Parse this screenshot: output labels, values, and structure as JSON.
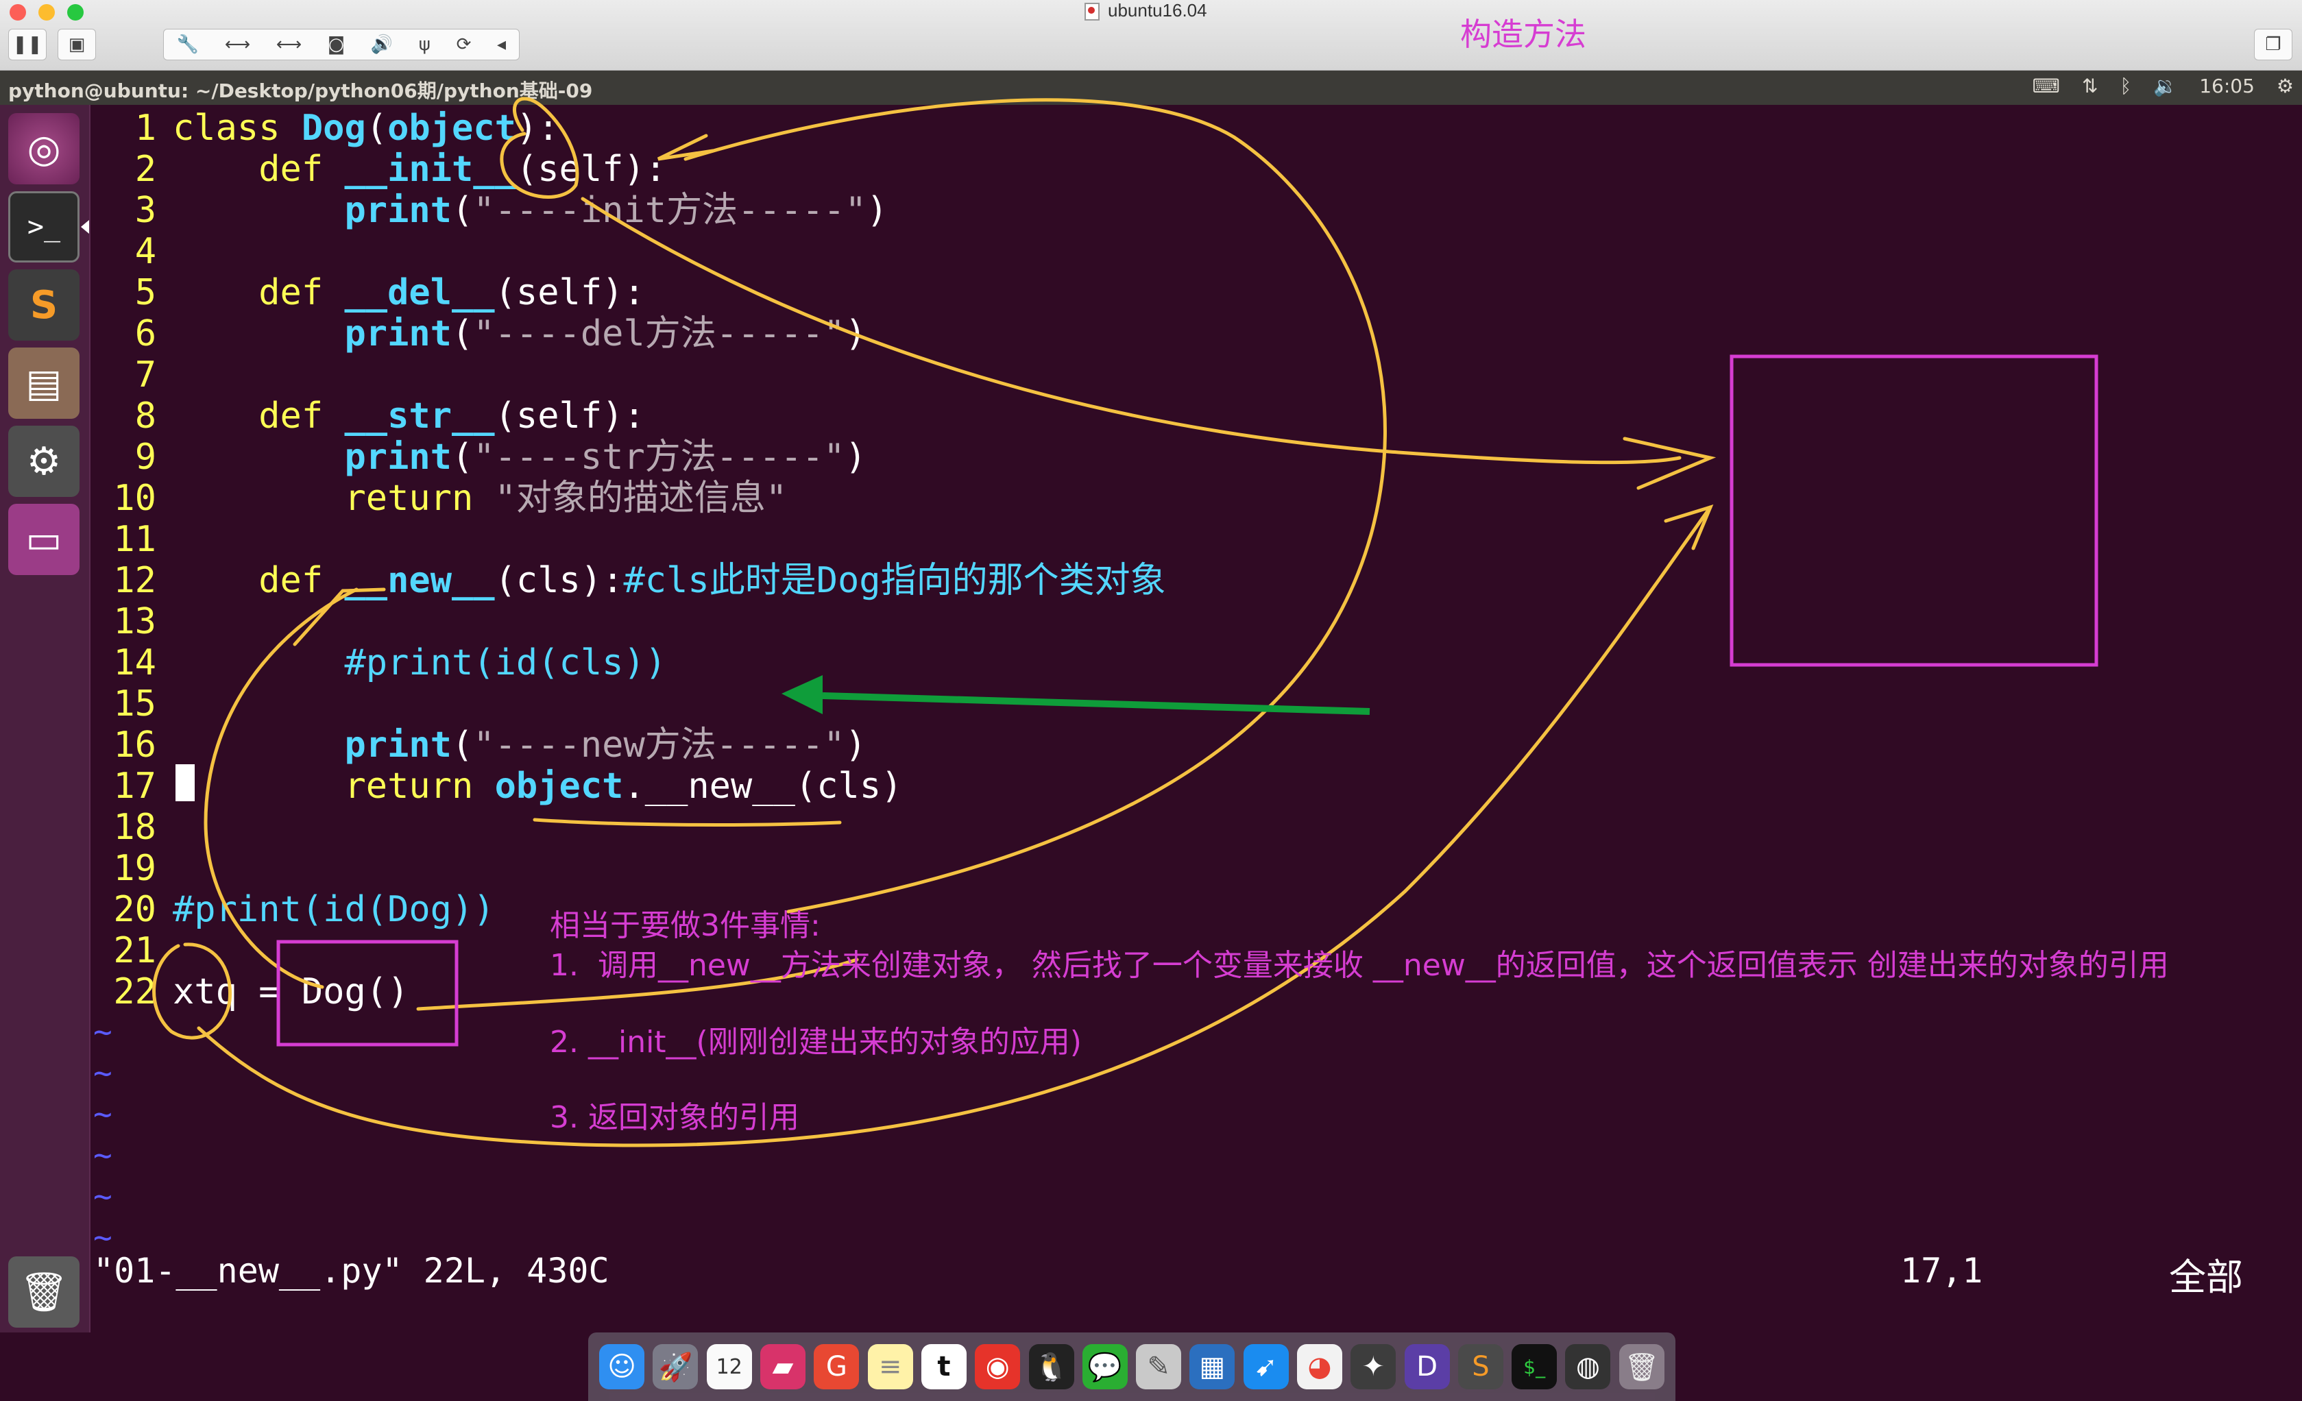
{
  "window": {
    "title": "ubuntu16.04",
    "overlay_title": "构造方法"
  },
  "panel": {
    "title": "python@ubuntu: ~/Desktop/python06期/python基础-09",
    "time": "16:05"
  },
  "launcher": {
    "apps": [
      "ubuntu-dash",
      "terminal",
      "sublime-text",
      "file-manager",
      "system-settings",
      "workspace-switcher",
      "trash"
    ]
  },
  "editor": {
    "lines": [
      {
        "n": "1",
        "text": "class Dog(object):"
      },
      {
        "n": "2",
        "text": "    def __init__(self):"
      },
      {
        "n": "3",
        "text": "        print(\"----init方法-----\")"
      },
      {
        "n": "4",
        "text": ""
      },
      {
        "n": "5",
        "text": "    def __del__(self):"
      },
      {
        "n": "6",
        "text": "        print(\"----del方法-----\")"
      },
      {
        "n": "7",
        "text": ""
      },
      {
        "n": "8",
        "text": "    def __str__(self):"
      },
      {
        "n": "9",
        "text": "        print(\"----str方法-----\")"
      },
      {
        "n": "10",
        "text": "        return \"对象的描述信息\""
      },
      {
        "n": "11",
        "text": ""
      },
      {
        "n": "12",
        "text": "    def __new__(cls):#cls此时是Dog指向的那个类对象"
      },
      {
        "n": "13",
        "text": ""
      },
      {
        "n": "14",
        "text": "        #print(id(cls))"
      },
      {
        "n": "15",
        "text": ""
      },
      {
        "n": "16",
        "text": "        print(\"----new方法-----\")"
      },
      {
        "n": "17",
        "text": "        return object.__new__(cls)"
      },
      {
        "n": "18",
        "text": ""
      },
      {
        "n": "19",
        "text": ""
      },
      {
        "n": "20",
        "text": "#print(id(Dog))"
      },
      {
        "n": "21",
        "text": ""
      },
      {
        "n": "22",
        "text": "xtq = Dog()"
      }
    ],
    "tilde_count": 6,
    "status_file": "\"01-__new__.py\" 22L, 430C",
    "status_position": "17,1",
    "status_all": "全部"
  },
  "annotations": {
    "heading": "相当于要做3件事情:",
    "step1": "1.  调用__new__方法来创建对象， 然后找了一个变量来接收 __new__的返回值，这个返回值表示 创建出来的对象的引用",
    "step2": "2. __init__(刚刚创建出来的对象的应用)",
    "step3": "3. 返回对象的引用",
    "colors": {
      "pen": "#f5c242",
      "box": "#d63dd2",
      "arrow": "#0f9d3a"
    }
  },
  "dock": {
    "apps": [
      "finder",
      "launchpad",
      "calendar",
      "photo-booth",
      "git-client",
      "notes",
      "typora",
      "weibo",
      "qq",
      "wechat",
      "script-editor",
      "vmware-fusion",
      "safari",
      "chrome",
      "instruments",
      "dash",
      "sublime-text",
      "terminal",
      "obs",
      "trash"
    ],
    "calendar_day": "12"
  }
}
